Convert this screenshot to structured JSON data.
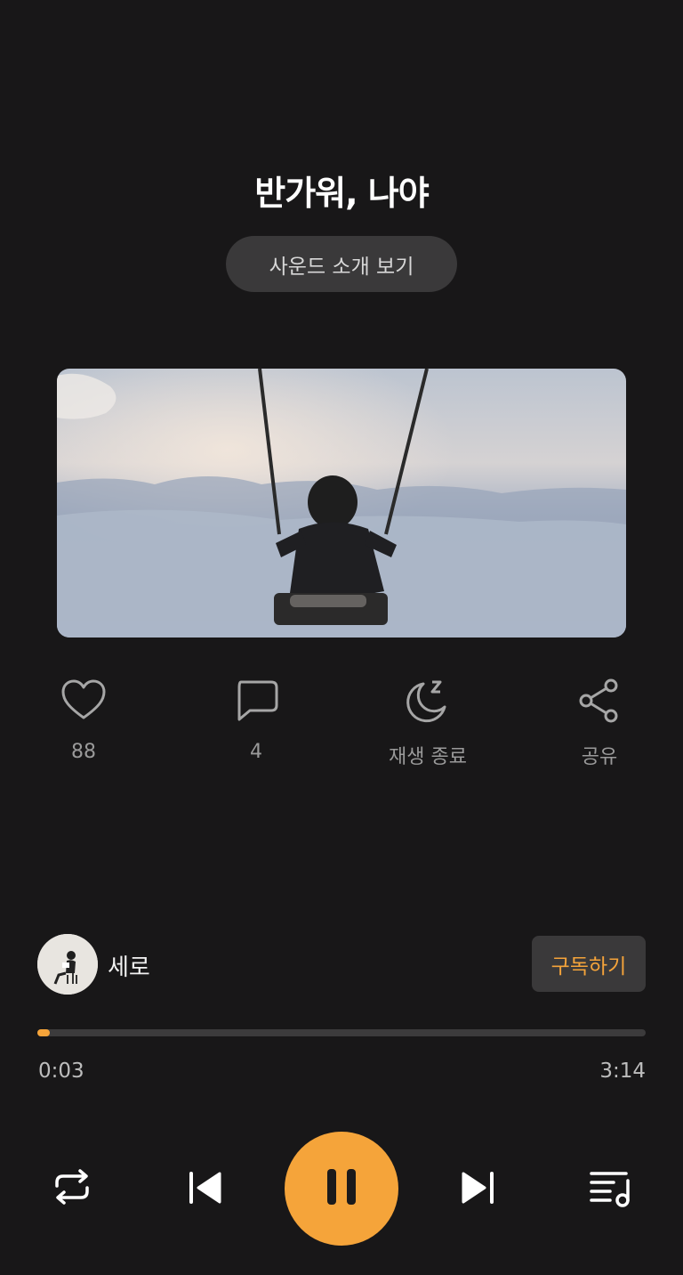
{
  "track": {
    "title": "반가워, 나야",
    "intro_button_label": "사운드 소개 보기"
  },
  "actions": {
    "like": {
      "icon": "heart-icon",
      "label": "88"
    },
    "comment": {
      "icon": "comment-icon",
      "label": "4"
    },
    "sleep_timer": {
      "icon": "moon-sleep-icon",
      "label": "재생 종료"
    },
    "share": {
      "icon": "share-icon",
      "label": "공유"
    }
  },
  "creator": {
    "name": "세로",
    "subscribe_label": "구독하기"
  },
  "player": {
    "current_time": "0:03",
    "total_time": "3:14",
    "progress_fraction": 0.016,
    "controls": [
      "repeat-icon",
      "previous-icon",
      "pause-icon",
      "next-icon",
      "playlist-icon"
    ]
  },
  "colors": {
    "accent": "#f5a43a",
    "background": "#181718",
    "chip_bg": "#3a393a"
  }
}
